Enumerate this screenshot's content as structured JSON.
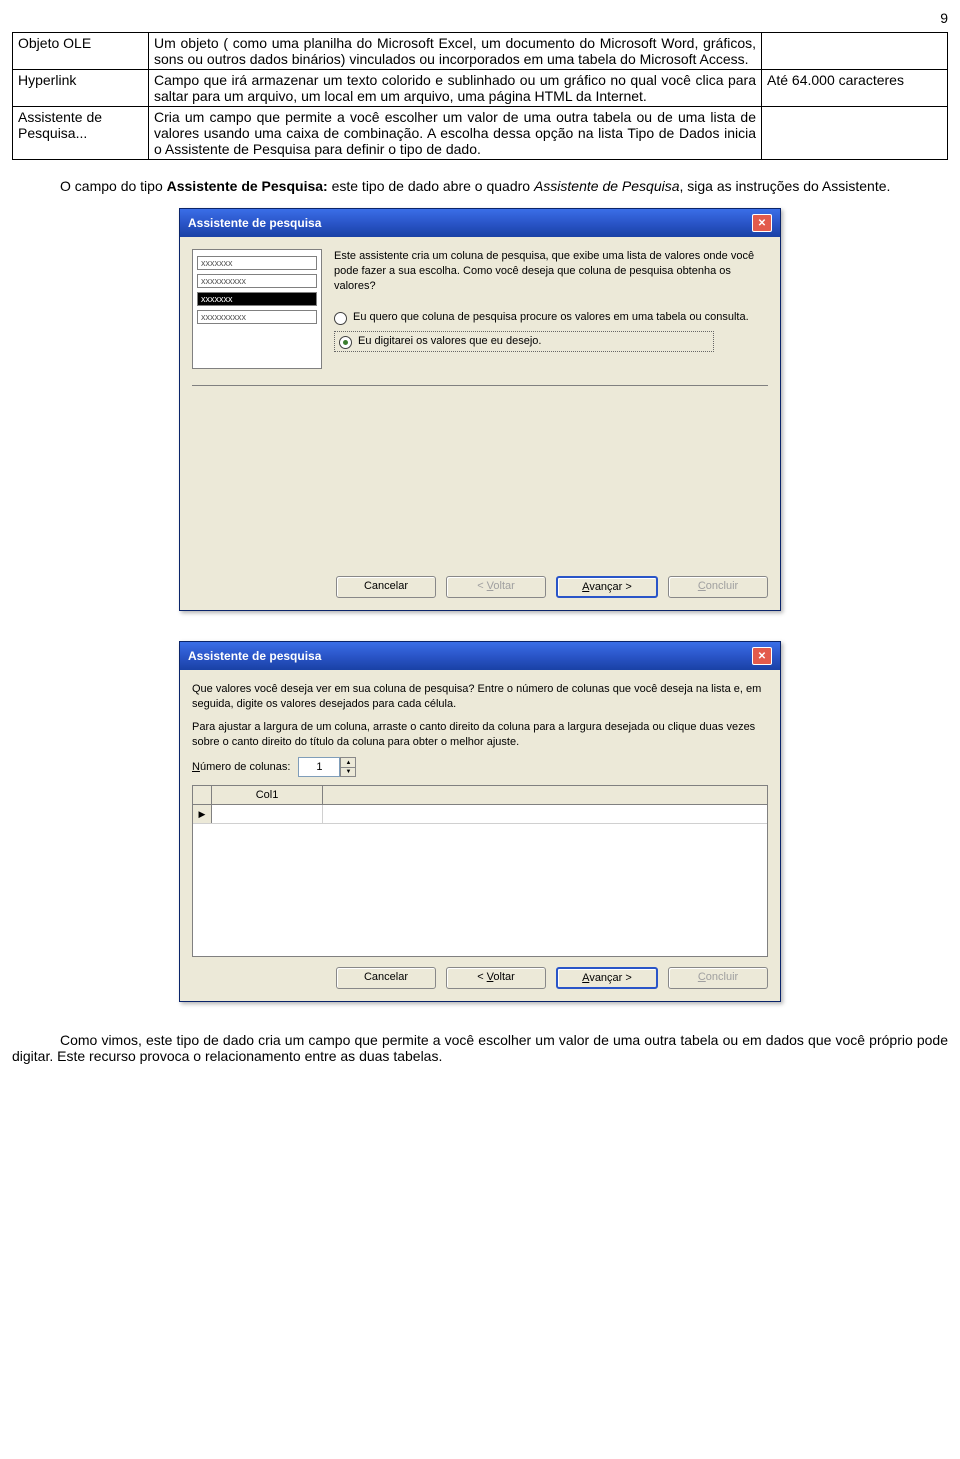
{
  "page_number": "9",
  "table": {
    "rows": [
      {
        "c1": "Objeto OLE",
        "c2": "Um objeto ( como uma planilha do Microsoft Excel, um documento do Microsoft Word, gráficos, sons ou outros dados binários) vinculados ou incorporados em uma tabela do Microsoft Access.",
        "c3": ""
      },
      {
        "c1": "Hyperlink",
        "c2": "Campo que irá armazenar um texto colorido e sublinhado ou um gráfico no qual você clica para saltar para um arquivo, um local em um arquivo, uma página HTML da Internet.",
        "c3": "Até 64.000 caracteres"
      },
      {
        "c1": "Assistente de Pesquisa...",
        "c2": "Cria um campo que permite a você escolher um valor de uma outra tabela ou de uma lista de valores usando uma caixa de combinação. A escolha dessa opção na lista Tipo de Dados inicia o Assistente de Pesquisa para definir o tipo de dado.",
        "c3": ""
      }
    ]
  },
  "paragraph1_pre": "O campo do tipo ",
  "paragraph1_bold": "Assistente de Pesquisa:",
  "paragraph1_mid": " este tipo de dado abre o quadro ",
  "paragraph1_italic": "Assistente de Pesquisa",
  "paragraph1_post": ", siga as instruções do Assistente.",
  "dialog1": {
    "title": "Assistente de pesquisa",
    "preview": [
      "xxxxxxx",
      "xxxxxxxxxx",
      "xxxxxxx",
      "xxxxxxxxxx"
    ],
    "intro": "Este assistente cria um coluna de pesquisa, que exibe uma lista de valores onde você pode fazer a sua escolha. Como você deseja que coluna de pesquisa obtenha os valores?",
    "radio1": "Eu quero que coluna de pesquisa procure os valores em uma tabela ou consulta.",
    "radio2": "Eu digitarei os valores que eu desejo.",
    "buttons": {
      "cancel": "Cancelar",
      "back": "< Voltar",
      "next": "Avançar >",
      "finish": "Concluir"
    }
  },
  "dialog2": {
    "title": "Assistente de pesquisa",
    "instr1": "Que valores você deseja ver em sua coluna de pesquisa? Entre o número de colunas que você deseja na lista e, em seguida, digite os valores desejados para cada célula.",
    "instr2": "Para ajustar a largura de um coluna, arraste o canto direito da coluna para a largura desejada ou clique duas vezes sobre o canto direito do título da coluna para obter o melhor ajuste.",
    "numcol_label": "Número de colunas:",
    "numcol_value": "1",
    "grid_col1": "Col1",
    "row_marker": "▶",
    "buttons": {
      "cancel": "Cancelar",
      "back": "< Voltar",
      "next": "Avançar >",
      "finish": "Concluir"
    }
  },
  "paragraph2": "Como vimos, este tipo de dado cria um campo que permite a você escolher um valor de uma outra tabela ou em dados que você próprio pode digitar. Este recurso provoca o relacionamento entre as duas tabelas."
}
